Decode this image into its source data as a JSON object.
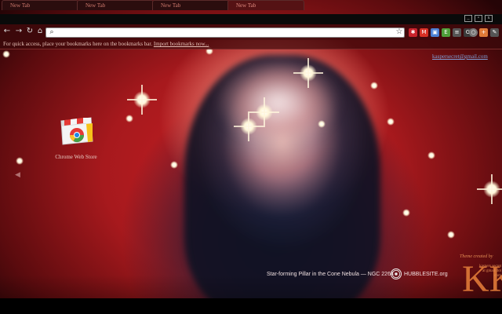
{
  "tabs": [
    {
      "label": "New Tab",
      "active": false
    },
    {
      "label": "New Tab",
      "active": false
    },
    {
      "label": "New Tab",
      "active": false
    },
    {
      "label": "New Tab",
      "active": true
    }
  ],
  "window_controls": {
    "minimize": "_",
    "restore": "▫",
    "close": "x"
  },
  "toolbar": {
    "back_icon": "←",
    "forward_icon": "→",
    "reload_icon": "↻",
    "omnibox_value": "",
    "extensions": [
      {
        "name": "pinterest-extension-icon",
        "glyph": "✱",
        "color": "#c8232c"
      },
      {
        "name": "gmail-extension-icon",
        "glyph": "M",
        "color": "#d93025"
      },
      {
        "name": "screenshot-extension-icon",
        "glyph": "▣",
        "color": "#4a7fd3"
      },
      {
        "name": "evernote-extension-icon",
        "glyph": "E",
        "color": "#4e9e3a"
      },
      {
        "name": "reader-extension-icon",
        "glyph": "≡",
        "color": "#555"
      },
      {
        "name": "google-extension-icon",
        "glyph": "G",
        "color": "#3a3a3a"
      },
      {
        "name": "circle-extension-icon",
        "glyph": "○",
        "color": "#777"
      },
      {
        "name": "plus-extension-icon",
        "glyph": "+",
        "color": "#e07a38"
      },
      {
        "name": "wrench-menu-icon",
        "glyph": "✎",
        "color": "#555"
      }
    ]
  },
  "bookmark_bar": {
    "message": "For quick access, place your bookmarks here on the bookmarks bar.",
    "import_link": "Import bookmarks now..."
  },
  "user_email": "kaspersecret@gmail.com",
  "apps": [
    {
      "label": "Chrome Web Store"
    }
  ],
  "attribution": {
    "caption": "Star-forming Pillar in the Cone Nebula — NGC 2264",
    "site": "HUBBLESITE.org"
  },
  "theme_credit": {
    "line": "Theme created by",
    "mark": "KK",
    "signature": "kaspers secret at gmail dot com"
  },
  "colors": {
    "accent": "#c81f24",
    "link": "#7fa0d8",
    "signature": "#e07a38"
  }
}
